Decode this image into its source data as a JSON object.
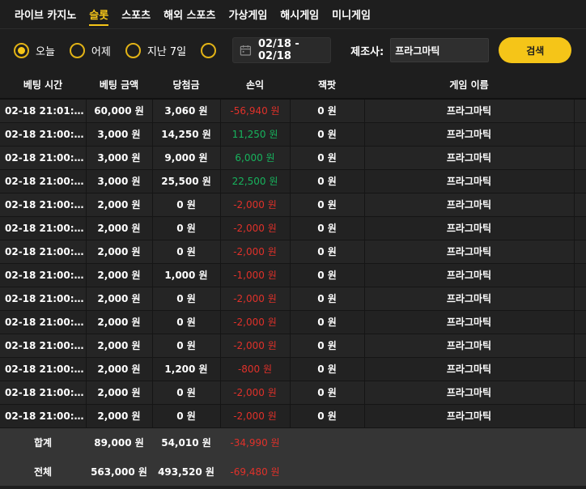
{
  "tabs": [
    {
      "label": "라이브 카지노",
      "active": false
    },
    {
      "label": "슬롯",
      "active": true
    },
    {
      "label": "스포츠",
      "active": false
    },
    {
      "label": "해외 스포츠",
      "active": false
    },
    {
      "label": "가상게임",
      "active": false
    },
    {
      "label": "해시게임",
      "active": false
    },
    {
      "label": "미니게임",
      "active": false
    }
  ],
  "filters": {
    "today": "오늘",
    "yesterday": "어제",
    "last7": "지난 7일",
    "selected": "today",
    "date_range": "02/18 - 02/18",
    "maker_label": "제조사:",
    "maker_value": "프라그마틱",
    "search_label": "검색"
  },
  "table": {
    "headers": [
      "베팅 시간",
      "베팅 금액",
      "당첨금",
      "손익",
      "잭팟",
      "게임 이름"
    ],
    "rows": [
      {
        "time": "02-18 21:01:…",
        "bet": "60,000 원",
        "win": "3,060 원",
        "pl": "-56,940 원",
        "pl_sign": "neg",
        "jackpot": "0 원",
        "game": "프라그마틱"
      },
      {
        "time": "02-18 21:00:…",
        "bet": "3,000 원",
        "win": "14,250 원",
        "pl": "11,250 원",
        "pl_sign": "pos",
        "jackpot": "0 원",
        "game": "프라그마틱"
      },
      {
        "time": "02-18 21:00:…",
        "bet": "3,000 원",
        "win": "9,000 원",
        "pl": "6,000 원",
        "pl_sign": "pos",
        "jackpot": "0 원",
        "game": "프라그마틱"
      },
      {
        "time": "02-18 21:00:…",
        "bet": "3,000 원",
        "win": "25,500 원",
        "pl": "22,500 원",
        "pl_sign": "pos",
        "jackpot": "0 원",
        "game": "프라그마틱"
      },
      {
        "time": "02-18 21:00:…",
        "bet": "2,000 원",
        "win": "0 원",
        "pl": "-2,000 원",
        "pl_sign": "neg",
        "jackpot": "0 원",
        "game": "프라그마틱"
      },
      {
        "time": "02-18 21:00:…",
        "bet": "2,000 원",
        "win": "0 원",
        "pl": "-2,000 원",
        "pl_sign": "neg",
        "jackpot": "0 원",
        "game": "프라그마틱"
      },
      {
        "time": "02-18 21:00:…",
        "bet": "2,000 원",
        "win": "0 원",
        "pl": "-2,000 원",
        "pl_sign": "neg",
        "jackpot": "0 원",
        "game": "프라그마틱"
      },
      {
        "time": "02-18 21:00:…",
        "bet": "2,000 원",
        "win": "1,000 원",
        "pl": "-1,000 원",
        "pl_sign": "neg",
        "jackpot": "0 원",
        "game": "프라그마틱"
      },
      {
        "time": "02-18 21:00:…",
        "bet": "2,000 원",
        "win": "0 원",
        "pl": "-2,000 원",
        "pl_sign": "neg",
        "jackpot": "0 원",
        "game": "프라그마틱"
      },
      {
        "time": "02-18 21:00:…",
        "bet": "2,000 원",
        "win": "0 원",
        "pl": "-2,000 원",
        "pl_sign": "neg",
        "jackpot": "0 원",
        "game": "프라그마틱"
      },
      {
        "time": "02-18 21:00:…",
        "bet": "2,000 원",
        "win": "0 원",
        "pl": "-2,000 원",
        "pl_sign": "neg",
        "jackpot": "0 원",
        "game": "프라그마틱"
      },
      {
        "time": "02-18 21:00:…",
        "bet": "2,000 원",
        "win": "1,200 원",
        "pl": "-800 원",
        "pl_sign": "neg",
        "jackpot": "0 원",
        "game": "프라그마틱"
      },
      {
        "time": "02-18 21:00:…",
        "bet": "2,000 원",
        "win": "0 원",
        "pl": "-2,000 원",
        "pl_sign": "neg",
        "jackpot": "0 원",
        "game": "프라그마틱"
      },
      {
        "time": "02-18 21:00:…",
        "bet": "2,000 원",
        "win": "0 원",
        "pl": "-2,000 원",
        "pl_sign": "neg",
        "jackpot": "0 원",
        "game": "프라그마틱"
      }
    ],
    "subtotal": {
      "label": "합계",
      "bet": "89,000 원",
      "win": "54,010 원",
      "pl": "-34,990 원"
    },
    "total": {
      "label": "전체",
      "bet": "563,000 원",
      "win": "493,520 원",
      "pl": "-69,480 원"
    }
  },
  "colors": {
    "accent": "#f5c518",
    "negative": "#e0312a",
    "positive": "#17b35d"
  }
}
